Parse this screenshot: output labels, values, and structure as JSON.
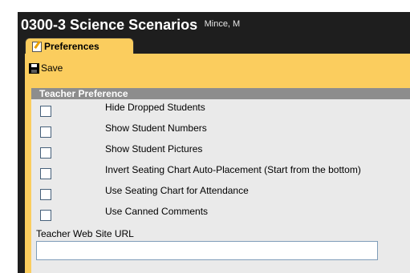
{
  "window": {
    "title": "0300-3 Science Scenarios",
    "teacher": "Mince, M"
  },
  "tabs": [
    {
      "label": "Preferences",
      "icon": "preferences-icon",
      "active": true
    }
  ],
  "toolbar": {
    "save_label": "Save",
    "save_icon": "floppy-disk-icon"
  },
  "section": {
    "header": "Teacher Preference",
    "options": [
      {
        "label": "Hide Dropped Students",
        "checked": false
      },
      {
        "label": "Show Student Numbers",
        "checked": false
      },
      {
        "label": "Show Student Pictures",
        "checked": false
      },
      {
        "label": "Invert Seating Chart Auto-Placement (Start from the bottom)",
        "checked": false
      },
      {
        "label": "Use Seating Chart for Attendance",
        "checked": false
      },
      {
        "label": "Use Canned Comments",
        "checked": false
      }
    ],
    "url_label": "Teacher Web Site URL",
    "url_value": ""
  },
  "colors": {
    "frame": "#1e1e1e",
    "accent": "#fbcd5e",
    "section_header": "#8d8d8d",
    "section_bg": "#eaeaea"
  }
}
